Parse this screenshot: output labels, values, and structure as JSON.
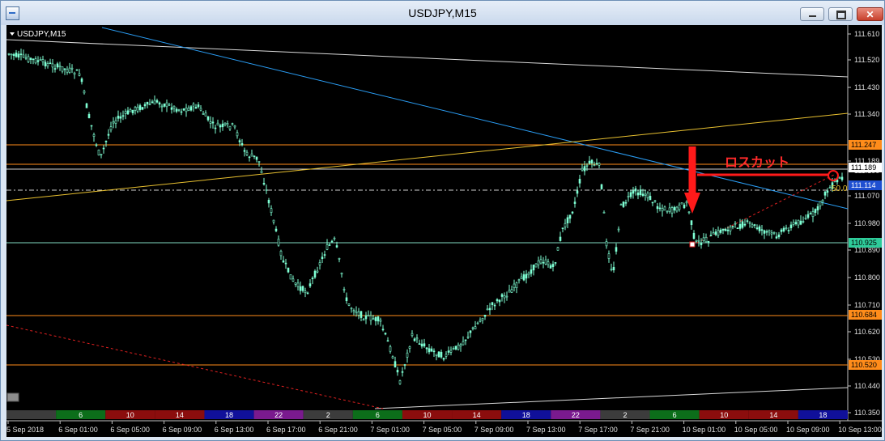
{
  "window": {
    "title": "USDJPY,M15"
  },
  "chart": {
    "symbol_label": "USDJPY,M15",
    "annotation_label": "ロスカット",
    "fib_marker": "50.0",
    "colors": {
      "background": "#000000",
      "candle": "#7fffd4",
      "price_axis_text": "#e0e0e0",
      "annotation": "#ff2a2a",
      "horizontal_orange": "#ff8c1a",
      "horizontal_white": "#cfcfcf",
      "blue_trend": "#2a9df4",
      "yellow_trend": "#e8c030",
      "dashed_red": "#e02020"
    },
    "price_labels": [
      "111.610",
      "111.520",
      "111.430",
      "111.340",
      "111.189",
      "111.100",
      "111.070",
      "110.980",
      "110.890",
      "110.800",
      "110.710",
      "110.620",
      "110.530",
      "110.440",
      "110.350"
    ],
    "level_tags": [
      {
        "price": "111.247",
        "bg": "#ff8c1a",
        "fg": "#000000"
      },
      {
        "price": "111.189",
        "bg": "#ffffff",
        "fg": "#000000"
      },
      {
        "price": "111.114",
        "bg": "#1f4fd1",
        "fg": "#ffffff"
      },
      {
        "price": "110.925",
        "bg": "#2ecc9a",
        "fg": "#000000"
      },
      {
        "price": "110.684",
        "bg": "#ff8c1a",
        "fg": "#000000"
      },
      {
        "price": "110.520",
        "bg": "#ff8c1a",
        "fg": "#000000"
      }
    ],
    "time_labels": [
      "5 Sep 2018",
      "6 Sep 01:00",
      "6 Sep 05:00",
      "6 Sep 09:00",
      "6 Sep 13:00",
      "6 Sep 17:00",
      "6 Sep 21:00",
      "7 Sep 01:00",
      "7 Sep 05:00",
      "7 Sep 09:00",
      "7 Sep 13:00",
      "7 Sep 17:00",
      "7 Sep 21:00",
      "10 Sep 01:00",
      "10 Sep 05:00",
      "10 Sep 09:00",
      "10 Sep 13:00"
    ],
    "session_bands": [
      {
        "label": "",
        "color": "#3c3c3c"
      },
      {
        "label": "6",
        "color": "#0c6e1a"
      },
      {
        "label": "10",
        "color": "#8b0d0d"
      },
      {
        "label": "14",
        "color": "#8b0d0d"
      },
      {
        "label": "18",
        "color": "#10109a"
      },
      {
        "label": "22",
        "color": "#7a1a8e"
      },
      {
        "label": "2",
        "color": "#3c3c3c"
      },
      {
        "label": "6",
        "color": "#0c6e1a"
      },
      {
        "label": "10",
        "color": "#8b0d0d"
      },
      {
        "label": "14",
        "color": "#8b0d0d"
      },
      {
        "label": "18",
        "color": "#10109a"
      },
      {
        "label": "22",
        "color": "#7a1a8e"
      },
      {
        "label": "2",
        "color": "#3c3c3c"
      },
      {
        "label": "6",
        "color": "#0c6e1a"
      },
      {
        "label": "10",
        "color": "#8b0d0d"
      },
      {
        "label": "14",
        "color": "#8b0d0d"
      },
      {
        "label": "18",
        "color": "#10109a"
      }
    ]
  }
}
